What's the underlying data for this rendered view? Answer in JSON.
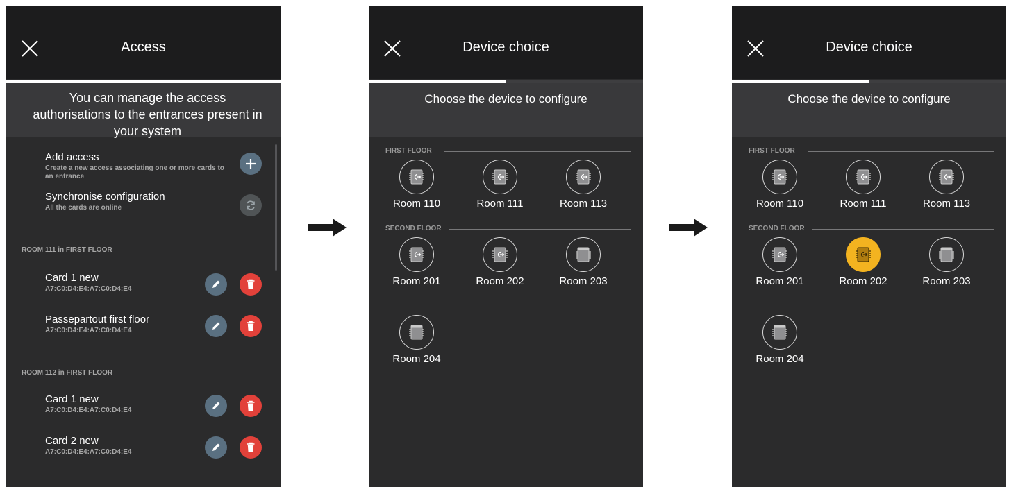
{
  "colors": {
    "selected": "#f3b320",
    "delete": "#e2413a",
    "edit": "#5a7081",
    "header_bg": "#1c1c1d",
    "panel_bg": "#2b2b2c"
  },
  "access": {
    "title": "Access",
    "progress": 1.0,
    "intro": "You can manage the access authorisations to the entrances present in your system",
    "add": {
      "title": "Add access",
      "desc": "Create a new access associating one or more cards to an entrance",
      "icon": "plus-icon"
    },
    "sync": {
      "title": "Synchronise configuration",
      "desc": "All the cards are online",
      "icon": "sync-icon"
    },
    "groups": [
      {
        "label": "ROOM 111 in FIRST FLOOR",
        "cards": [
          {
            "name": "Card 1 new",
            "mac": "A7:C0:D4:E4:A7:C0:D4:E4"
          },
          {
            "name": "Passepartout first floor",
            "mac": "A7:C0:D4:E4:A7:C0:D4:E4"
          }
        ]
      },
      {
        "label": "ROOM 112 in FIRST FLOOR",
        "cards": [
          {
            "name": "Card 1 new",
            "mac": "A7:C0:D4:E4:A7:C0:D4:E4"
          },
          {
            "name": "Card 2 new",
            "mac": "A7:C0:D4:E4:A7:C0:D4:E4"
          }
        ]
      }
    ]
  },
  "device_choice_1": {
    "title": "Device choice",
    "progress": 0.5,
    "prompt": "Choose the device to configure",
    "floors": [
      {
        "label": "FIRST FLOOR",
        "rooms": [
          "Room 110",
          "Room 111",
          "Room 113"
        ]
      },
      {
        "label": "SECOND FLOOR",
        "rooms": [
          "Room 201",
          "Room 202",
          "Room 203",
          "Room 204"
        ]
      }
    ],
    "selected": ""
  },
  "device_choice_2": {
    "title": "Device choice",
    "progress": 0.5,
    "prompt": "Choose the device to configure",
    "floors": [
      {
        "label": "FIRST FLOOR",
        "rooms": [
          "Room 110",
          "Room 111",
          "Room 113"
        ]
      },
      {
        "label": "SECOND FLOOR",
        "rooms": [
          "Room 201",
          "Room 202",
          "Room 203",
          "Room 204"
        ]
      }
    ],
    "selected": "Room 202"
  },
  "device_icons": {
    "Room 110": "access-reader-icon",
    "Room 111": "access-reader-icon",
    "Room 113": "access-reader-icon",
    "Room 201": "access-reader-icon",
    "Room 202": "access-reader-icon",
    "Room 203": "card-switch-icon",
    "Room 204": "card-switch-icon"
  }
}
